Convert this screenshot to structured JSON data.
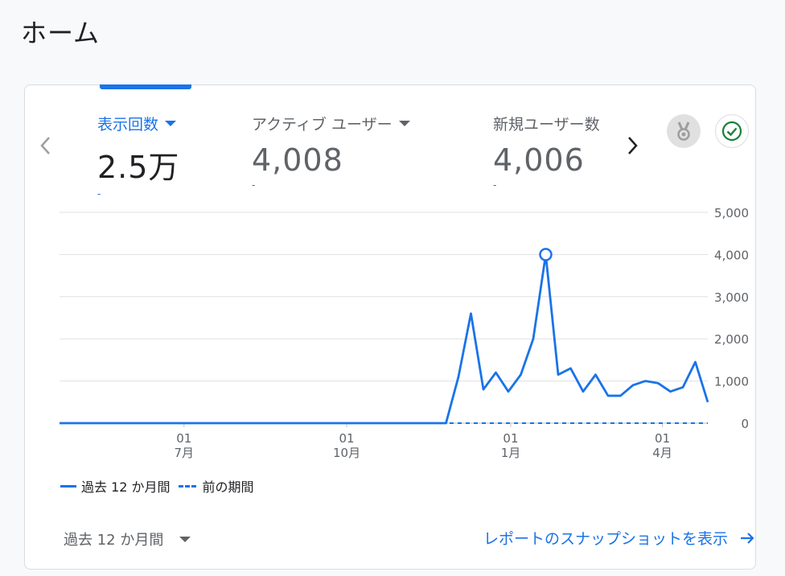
{
  "page": {
    "title": "ホーム"
  },
  "card": {
    "metrics": [
      {
        "label": "表示回数",
        "value": "2.5万",
        "change": "-",
        "active": true
      },
      {
        "label": "アクティブ ユーザー",
        "value": "4,008",
        "change": "-",
        "active": false
      },
      {
        "label": "新規ユーザー数",
        "value": "4,006",
        "change": "-",
        "active": false
      }
    ],
    "icons": {
      "prev": "chevron-left-icon",
      "next": "chevron-right-icon",
      "badge": "medal-badge-icon",
      "check": "check-circle-icon"
    }
  },
  "colors": {
    "accent": "#1a73e8",
    "text": "#202124",
    "muted": "#5f6368",
    "grid": "#e0e0e0",
    "success": "#188038"
  },
  "chart_data": {
    "type": "line",
    "y_ticks": [
      "5,000",
      "4,000",
      "3,000",
      "2,000",
      "1,000",
      "0"
    ],
    "ylim": [
      0,
      5000
    ],
    "x_ticks": [
      {
        "day": "01",
        "month": "7月"
      },
      {
        "day": "01",
        "month": "10月"
      },
      {
        "day": "01",
        "month": "1月"
      },
      {
        "day": "01",
        "month": "4月"
      }
    ],
    "grid": true,
    "legend": {
      "position": "bottom-left"
    },
    "series": [
      {
        "name": "過去 12 か月間",
        "style": "solid",
        "values": [
          0,
          0,
          0,
          0,
          0,
          0,
          0,
          0,
          0,
          0,
          0,
          0,
          0,
          0,
          0,
          0,
          0,
          0,
          0,
          0,
          0,
          0,
          0,
          0,
          0,
          0,
          0,
          0,
          0,
          0,
          0,
          0,
          1100,
          2600,
          800,
          1200,
          750,
          1150,
          2000,
          4000,
          1150,
          1300,
          750,
          1150,
          650,
          650,
          900,
          1000,
          950,
          750,
          850,
          1450,
          500
        ],
        "highlight_index": 39
      },
      {
        "name": "前の期間",
        "style": "dashed",
        "values": [
          0,
          0,
          0,
          0,
          0,
          0,
          0,
          0,
          0,
          0,
          0,
          0,
          0,
          0,
          0,
          0,
          0,
          0,
          0,
          0,
          0,
          0,
          0,
          0,
          0,
          0,
          0,
          0,
          0,
          0,
          0,
          0,
          0,
          0,
          0,
          0,
          0,
          0,
          0,
          0,
          0,
          0,
          0,
          0,
          0,
          0,
          0,
          0,
          0,
          0,
          0,
          0,
          0
        ]
      }
    ]
  },
  "footer": {
    "date_range_label": "過去 12 か月間",
    "report_link_label": "レポートのスナップショットを表示"
  }
}
